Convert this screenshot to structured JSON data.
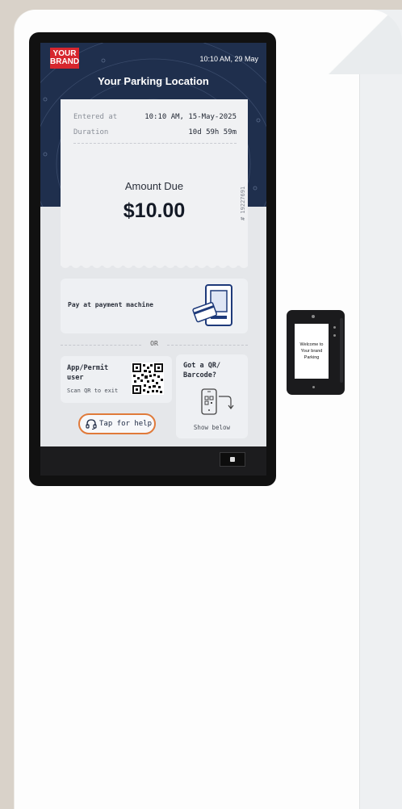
{
  "brand": {
    "line1": "YOUR",
    "line2": "BRAND"
  },
  "header": {
    "datetime": "10:10 AM, 29 May",
    "title": "Your Parking Location"
  },
  "ticket": {
    "rows": [
      {
        "label": "Entered at",
        "value": "10:10 AM, 15-May-2025"
      },
      {
        "label": "Duration",
        "value": "10d 59h 59m"
      }
    ],
    "amount_label": "Amount Due",
    "amount_value": "$10.00",
    "ticket_id": "# 19227691"
  },
  "pay_card": {
    "label": "Pay at payment machine",
    "icon": "payment-machine-icon"
  },
  "divider": {
    "text": "OR"
  },
  "app_card": {
    "title": "App/Permit user",
    "subtitle": "Scan QR to exit",
    "icon": "qr-code-icon"
  },
  "barcode_card": {
    "title": "Got a QR/ Barcode?",
    "subtitle": "Show below",
    "icon": "phone-qr-icon"
  },
  "help_button": {
    "label": "Tap for help",
    "icon": "headset-icon"
  },
  "terminal": {
    "line1": "Welcome to",
    "line2": "Your brand",
    "line3": "Parking"
  },
  "colors": {
    "navy": "#1f2f4d",
    "brand_red": "#d7262e",
    "help_orange": "#e07a3a"
  }
}
